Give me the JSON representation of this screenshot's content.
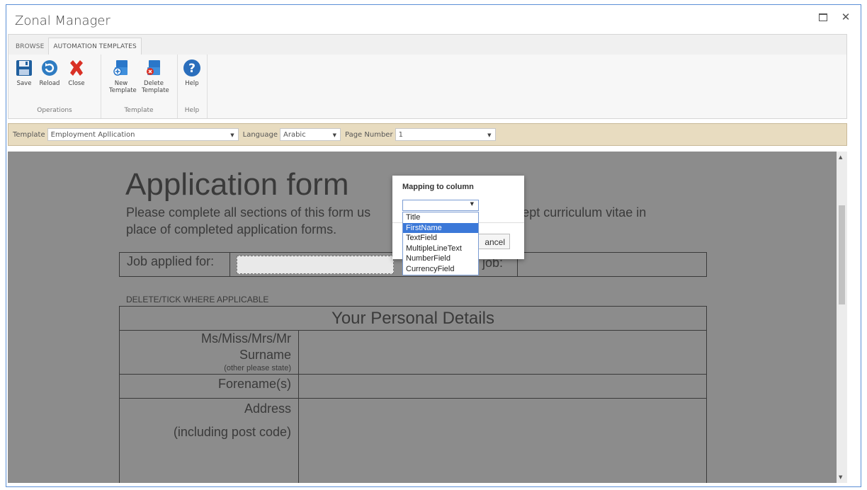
{
  "window": {
    "title": "Zonal Manager"
  },
  "ribbon": {
    "tabs": [
      {
        "label": "BROWSE"
      },
      {
        "label": "AUTOMATION TEMPLATES"
      }
    ],
    "groups": {
      "operations": {
        "label": "Operations",
        "save": "Save",
        "reload": "Reload",
        "close": "Close"
      },
      "template": {
        "label": "Template",
        "new_line1": "New",
        "new_line2": "Template",
        "delete_line1": "Delete",
        "delete_line2": "Template"
      },
      "help": {
        "label": "Help",
        "help": "Help"
      }
    },
    "colors": {
      "save": "#1f5f9e",
      "reload": "#2f7cc2",
      "close": "#d93025",
      "help": "#2a6ebc"
    }
  },
  "toolbar": {
    "template_label": "Template",
    "template_value": "Employment Apllication",
    "language_label": "Language",
    "language_value": "Arabic",
    "page_label": "Page Number",
    "page_value": "1"
  },
  "document": {
    "title": "Application form",
    "intro_line1_left": "Please complete all sections of this form us",
    "intro_line1_right": "not accept curriculum vitae in",
    "intro_line2": "place of completed application forms.",
    "job_applied_label": "Job applied for:",
    "job_right_label": "job:",
    "delete_tick": "DELETE/TICK WHERE APPLICABLE",
    "section_title": "Your Personal Details",
    "ms_label": "Ms/Miss/Mrs/Mr",
    "surname_label": "Surname",
    "other_state": "(other please state)",
    "forename_label": "Forename(s)",
    "address_label": "Address",
    "postcode_label": "(including post code)"
  },
  "dialog": {
    "title": "Mapping to column",
    "selected_value": "",
    "cancel_label": "ancel",
    "options": [
      {
        "label": "Title"
      },
      {
        "label": "FirstName"
      },
      {
        "label": "TextField"
      },
      {
        "label": "MultipleLineText"
      },
      {
        "label": "NumberField"
      },
      {
        "label": "CurrencyField"
      }
    ],
    "highlighted": "FirstName"
  }
}
